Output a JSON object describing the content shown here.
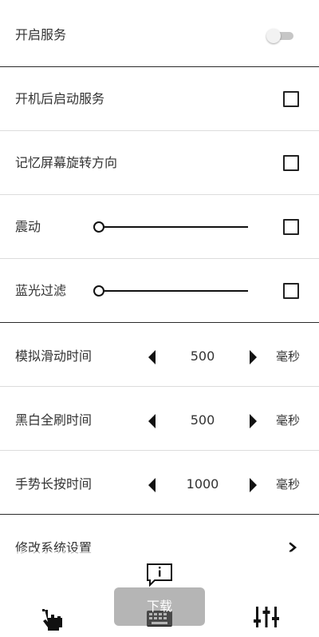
{
  "settings": {
    "enable_service": {
      "label": "开启服务",
      "enabled": false
    },
    "start_on_boot": {
      "label": "开机后启动服务",
      "checked": false
    },
    "remember_rotation": {
      "label": "记忆屏幕旋转方向",
      "checked": false
    },
    "vibration": {
      "label": "震动",
      "level": 0,
      "checked": false
    },
    "blue_light_filter": {
      "label": "蓝光过滤",
      "level": 0,
      "checked": false
    },
    "simulated_slide_time": {
      "label": "模拟滑动时间",
      "value": "500",
      "unit": "毫秒"
    },
    "full_refresh_time": {
      "label": "黑白全刷时间",
      "value": "500",
      "unit": "毫秒"
    },
    "long_press_time": {
      "label": "手势长按时间",
      "value": "1000",
      "unit": "毫秒"
    },
    "system_settings": {
      "label": "修改系统设置"
    }
  },
  "toast": {
    "text": "下载"
  },
  "icons": {
    "info": "info-speech-bubble-icon",
    "gesture": "hand-tap-icon",
    "keyboard": "keyboard-icon",
    "equalizer": "sliders-icon",
    "chevron": "chevron-right-icon"
  },
  "colors": {
    "toggle_track": "#c6c6c6",
    "toggle_knob": "#f2f2f2",
    "toast_bg": "#787878"
  }
}
